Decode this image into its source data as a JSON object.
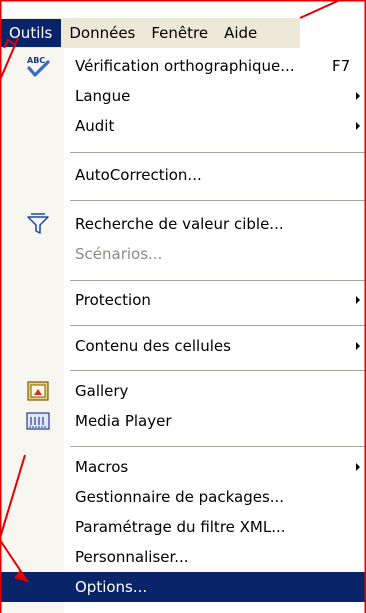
{
  "menubar": {
    "items": [
      {
        "label": "Outils",
        "active": true
      },
      {
        "label": "Données",
        "active": false
      },
      {
        "label": "Fenêtre",
        "active": false
      },
      {
        "label": "Aide",
        "active": false
      }
    ]
  },
  "menu": {
    "spelling": {
      "label": "Vérification orthographique...",
      "shortcut": "F7",
      "icon": "spellcheck-abc-icon"
    },
    "language": {
      "label": "Langue"
    },
    "audit": {
      "label": "Audit"
    },
    "autocorrect": {
      "label": "AutoCorrection..."
    },
    "goal_seek": {
      "label": "Recherche de valeur cible...",
      "icon": "goal-seek-funnel-icon"
    },
    "scenarios": {
      "label": "Scénarios..."
    },
    "protection": {
      "label": "Protection"
    },
    "cell_contents": {
      "label": "Contenu des cellules"
    },
    "gallery": {
      "label": "Gallery",
      "icon": "gallery-picture-icon"
    },
    "media_player": {
      "label": "Media Player",
      "icon": "media-player-icon"
    },
    "macros": {
      "label": "Macros"
    },
    "package_manager": {
      "label": "Gestionnaire de packages..."
    },
    "xml_filter": {
      "label": "Paramétrage du filtre XML..."
    },
    "customize": {
      "label": "Personnaliser..."
    },
    "options": {
      "label": "Options..."
    }
  },
  "colors": {
    "highlight": "#0a246a",
    "annotation": "#e00000",
    "disabled": "#8c8a84"
  }
}
